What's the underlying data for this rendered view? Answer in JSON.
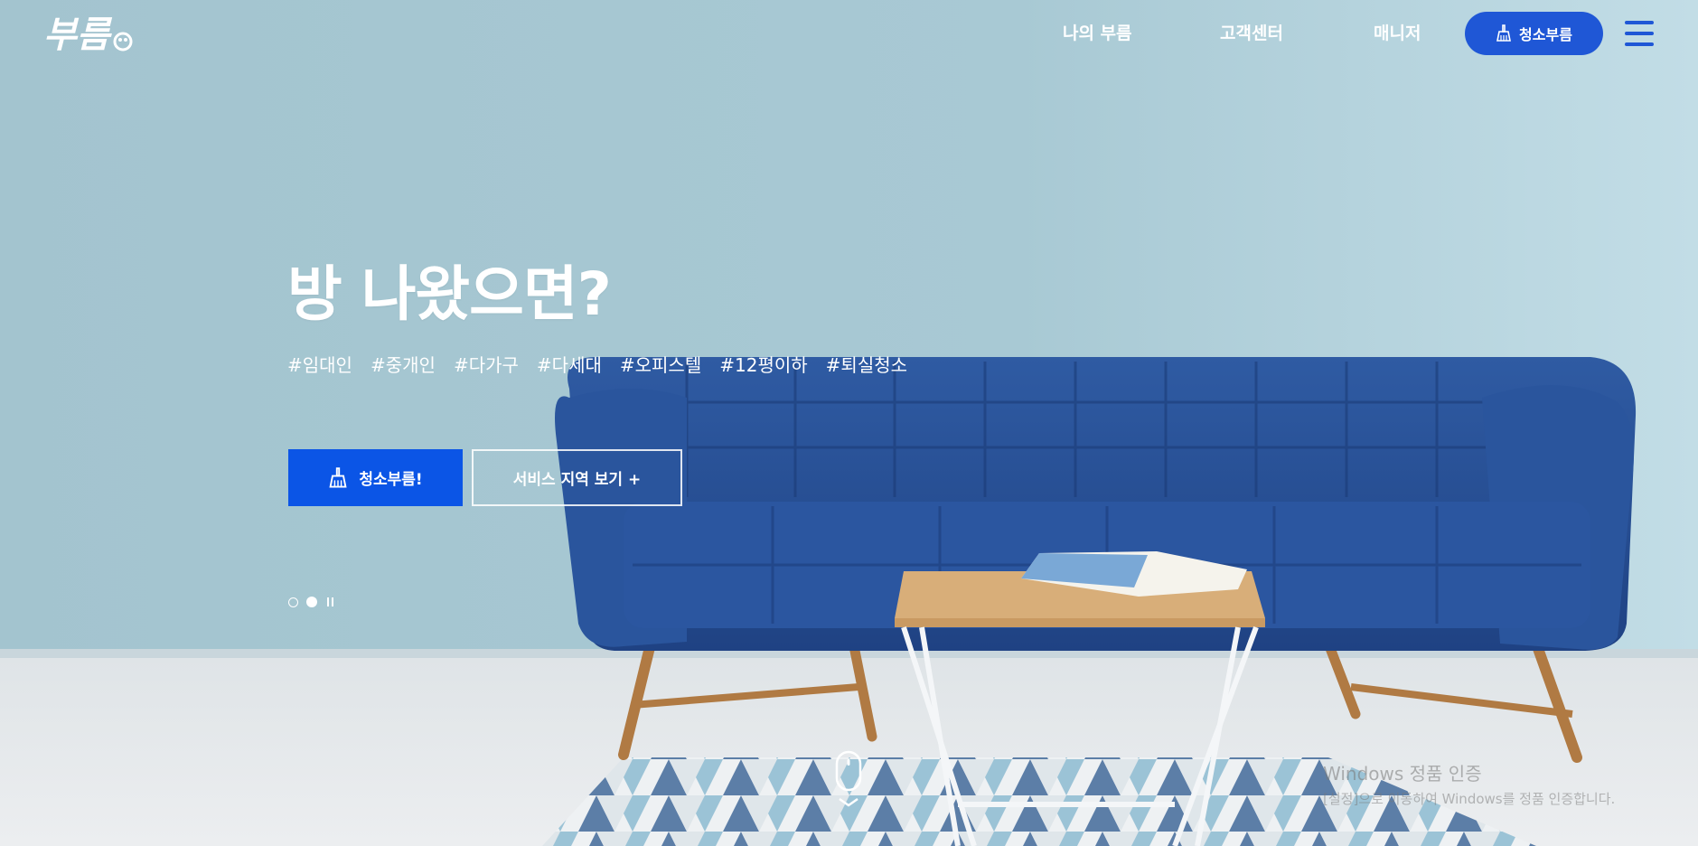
{
  "header": {
    "logo_text": "부름",
    "nav": {
      "my_bureum": "나의 부름",
      "customer_center": "고객센터",
      "manager": "매니저"
    },
    "cta_label": "청소부름",
    "cta_icon": "broom-icon",
    "menu_icon": "hamburger-icon"
  },
  "hero": {
    "headline": "방 나왔으면?",
    "tags": [
      "#임대인",
      "#중개인",
      "#다가구",
      "#다세대",
      "#오피스텔",
      "#12평이하",
      "#퇴실청소"
    ],
    "primary_button": "청소부름!",
    "secondary_button": "서비스 지역 보기 +",
    "slider": {
      "total": 2,
      "active_index": 2,
      "state": "playing"
    }
  },
  "overlay": {
    "windows_activation_title": "Windows 정품 인증",
    "windows_activation_sub": "[설정]으로 이동하여 Windows를 정품 인증합니다."
  },
  "colors": {
    "wall": "#a5c8d3",
    "sofa": "#244a8e",
    "primary_blue": "#0b55e6",
    "nav_blue": "#1f57d6"
  }
}
